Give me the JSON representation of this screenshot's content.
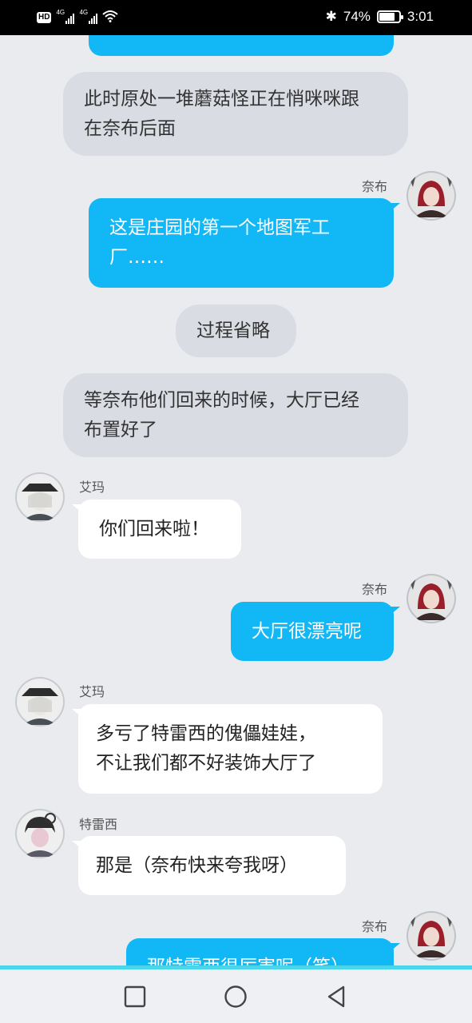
{
  "status_bar": {
    "hd": "HD",
    "sim1": "4G",
    "sim2": "4G",
    "bluetooth": "✱",
    "battery": "74%",
    "time": "3:01"
  },
  "messages": [
    {
      "type": "narration",
      "text": "此时原处一堆蘑菇怪正在悄咪咪跟在奈布后面",
      "lines": [
        "此时原处一堆蘑菇怪正在悄咪咪跟",
        "在奈布后面"
      ]
    },
    {
      "type": "mine",
      "sender": "奈布",
      "lines": [
        "这是庄园的第一个地图军工",
        "厂……"
      ]
    },
    {
      "type": "narration",
      "text": "过程省略"
    },
    {
      "type": "narration",
      "lines": [
        "等奈布他们回来的时候，大厅已经",
        "布置好了"
      ]
    },
    {
      "type": "theirs",
      "sender": "艾玛",
      "text": "你们回来啦！"
    },
    {
      "type": "mine",
      "sender": "奈布",
      "text": "大厅很漂亮呢"
    },
    {
      "type": "theirs",
      "sender": "艾玛",
      "lines": [
        "多亏了特雷西的傀儡娃娃，",
        "不让我们都不好装饰大厅了"
      ]
    },
    {
      "type": "theirs",
      "sender": "特雷西",
      "text": "那是（奈布快来夸我呀）"
    },
    {
      "type": "mine",
      "sender": "奈布",
      "text": "那特雷西很厉害呢（笑）"
    }
  ],
  "colors": {
    "background": "#e9ebef",
    "mine_bubble": "#12b7f5",
    "narration_bubble": "#d9dce3",
    "theirs_bubble": "#ffffff"
  },
  "navbar": {
    "icons": [
      "square-recents-icon",
      "circle-home-icon",
      "triangle-back-icon"
    ]
  }
}
